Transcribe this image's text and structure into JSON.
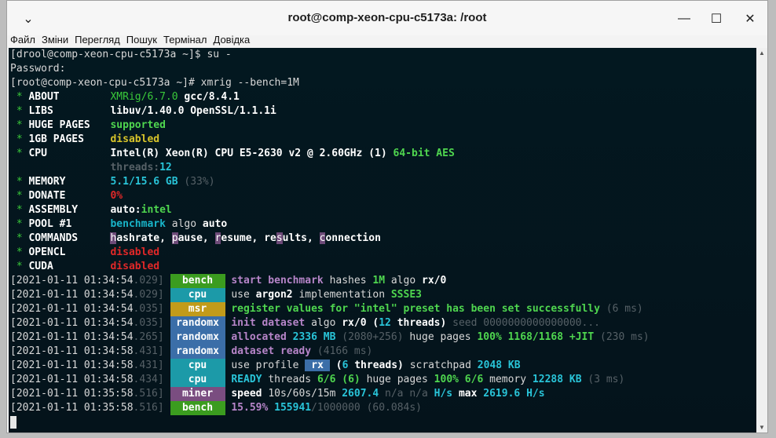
{
  "window": {
    "title": "root@comp-xeon-cpu-c5173a: /root",
    "controls": {
      "chevron": "⌄",
      "minimize": "—",
      "maximize": "☐",
      "close": "✕"
    }
  },
  "menu": [
    "Файл",
    "Зміни",
    "Перегляд",
    "Пошук",
    "Термінал",
    "Довідка"
  ],
  "terminal": {
    "cmd1_prompt": "[drool@comp-xeon-cpu-c5173a ~]$ ",
    "cmd1": "su -",
    "password": "Password:",
    "cmd2_prompt": "[root@comp-xeon-cpu-c5173a ~]# ",
    "cmd2": "xmrig --bench=1M",
    "about": {
      "label": "ABOUT",
      "name": "XMRig/6.7.0",
      "gcc": "gcc/8.4.1"
    },
    "libs": {
      "label": "LIBS",
      "value": "libuv/1.40.0 OpenSSL/1.1.1i"
    },
    "huge_pages": {
      "label": "HUGE PAGES",
      "value": "supported"
    },
    "gb_pages": {
      "label": "1GB PAGES",
      "value": "disabled"
    },
    "cpu": {
      "label": "CPU",
      "value": "Intel(R) Xeon(R) CPU E5-2630 v2 @ 2.60GHz (1)",
      "extra": "64-bit AES"
    },
    "threads": {
      "label": "threads:",
      "value": "12"
    },
    "memory": {
      "label": "MEMORY",
      "value": "5.1/15.6 GB",
      "pct": "(33%)"
    },
    "donate": {
      "label": "DONATE",
      "value": "0%"
    },
    "assembly": {
      "label": "ASSEMBLY",
      "pre": "auto:",
      "value": "intel"
    },
    "pool": {
      "label": "POOL #1",
      "a": "benchmark",
      "b": "algo",
      "c": "auto"
    },
    "commands": {
      "label": "COMMANDS",
      "items": [
        [
          "h",
          "ashrate"
        ],
        [
          "p",
          "ause"
        ],
        [
          "r",
          "esume"
        ],
        [
          "re",
          "s",
          "ults"
        ],
        [
          "c",
          "onnection"
        ]
      ]
    },
    "opencl": {
      "label": "OPENCL",
      "value": "disabled"
    },
    "cuda": {
      "label": "CUDA",
      "value": "disabled"
    },
    "logs": [
      {
        "ts": "[2021-01-11 01:34:54",
        "ms": ".029]",
        "tag": "bench"
      },
      {
        "ts": "[2021-01-11 01:34:54",
        "ms": ".029]",
        "tag": "cpu"
      },
      {
        "ts": "[2021-01-11 01:34:54",
        "ms": ".035]",
        "tag": "msr"
      },
      {
        "ts": "[2021-01-11 01:34:54",
        "ms": ".035]",
        "tag": "randomx"
      },
      {
        "ts": "[2021-01-11 01:34:54",
        "ms": ".265]",
        "tag": "randomx"
      },
      {
        "ts": "[2021-01-11 01:34:58",
        "ms": ".431]",
        "tag": "randomx"
      },
      {
        "ts": "[2021-01-11 01:34:58",
        "ms": ".431]",
        "tag": "cpu"
      },
      {
        "ts": "[2021-01-11 01:34:58",
        "ms": ".434]",
        "tag": "cpu"
      },
      {
        "ts": "[2021-01-11 01:35:58",
        "ms": ".516]",
        "tag": "miner"
      },
      {
        "ts": "[2021-01-11 01:35:58",
        "ms": ".516]",
        "tag": "bench"
      }
    ],
    "m1": {
      "a": "start benchmark",
      "b": "hashes",
      "c": "1M",
      "d": "algo",
      "e": "rx/0"
    },
    "m2": {
      "a": "use",
      "b": "argon2",
      "c": "implementation",
      "d": "SSSE3"
    },
    "m3": {
      "a": "register values for \"intel\" preset has been set successfully",
      "b": "(6 ms)"
    },
    "m4": {
      "a": "init dataset",
      "b": "algo",
      "c": "rx/0",
      "d": "(",
      "e": "12",
      "f": "threads",
      "g": ")",
      "h": "seed 0000000000000000..."
    },
    "m5": {
      "a": "allocated",
      "b": "2336 MB",
      "c": "(2080+256)",
      "d": "huge pages",
      "e": "100% 1168/1168 +JIT",
      "f": "(230 ms)"
    },
    "m6": {
      "a": "dataset ready",
      "b": "(4166 ms)"
    },
    "m7": {
      "a": "use profile",
      "b": "rx",
      "c": "(",
      "d": "6",
      "e": "threads",
      "f": ")",
      "g": "scratchpad",
      "h": "2048 KB"
    },
    "m8": {
      "a": "READY",
      "b": "threads",
      "c": "6/6 (6)",
      "d": "huge pages",
      "e": "100% 6/6",
      "f": "memory",
      "g": "12288 KB",
      "h": "(3 ms)"
    },
    "m9": {
      "a": "speed",
      "b": "10s/60s/15m",
      "c": "2607.4",
      "d": "n/a n/a",
      "e": "H/s",
      "f": "max",
      "g": "2619.6 H/s"
    },
    "m10": {
      "a": "15.59%",
      "b": "155941",
      "c": "/1000000",
      "d": "(60.084s)"
    }
  }
}
